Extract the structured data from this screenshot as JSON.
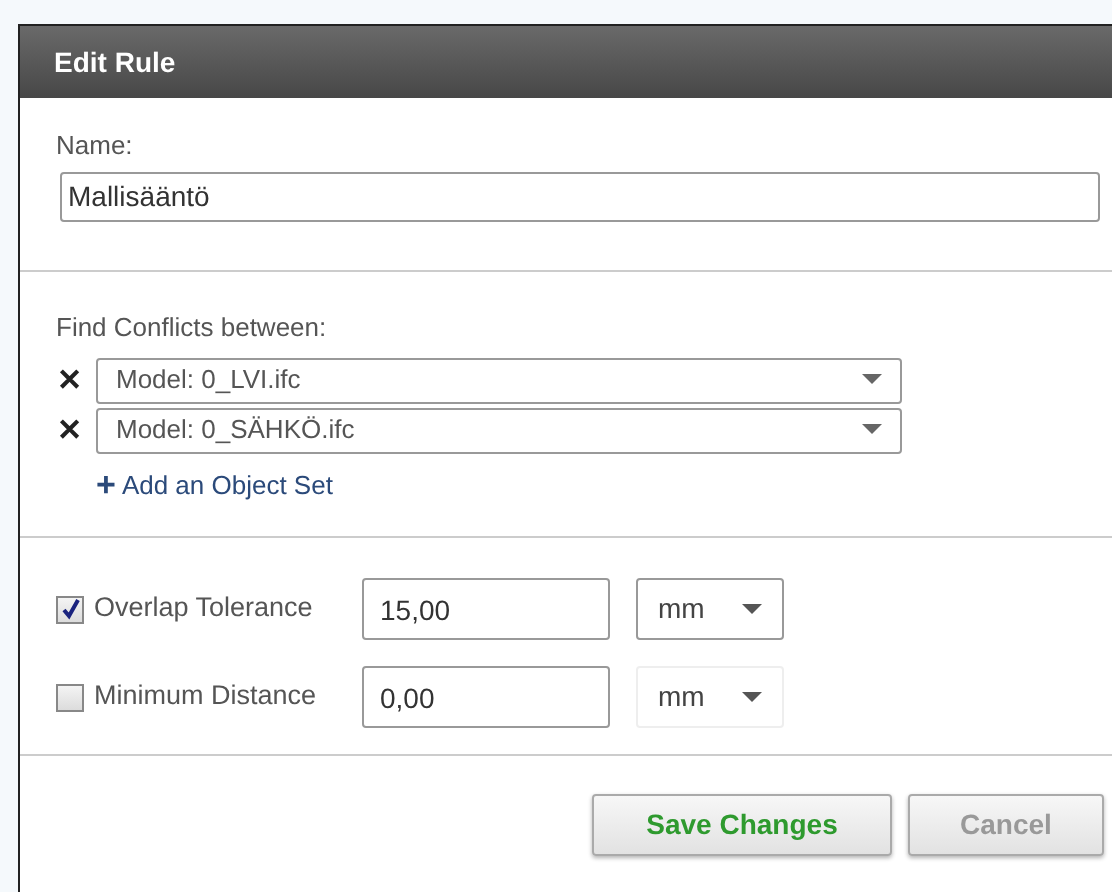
{
  "dialog": {
    "title": "Edit Rule"
  },
  "name_field": {
    "label": "Name:",
    "value": "Mallisääntö"
  },
  "conflicts": {
    "label": "Find Conflicts between:",
    "object_sets": [
      {
        "remove": "✕",
        "value": "Model: 0_LVI.ifc"
      },
      {
        "remove": "✕",
        "value": "Model: 0_SÄHKÖ.ifc"
      }
    ],
    "add_link": {
      "icon": "+",
      "label": "Add an Object Set"
    }
  },
  "tolerances": [
    {
      "label": "Overlap Tolerance",
      "checked": true,
      "value": "15,00",
      "unit": "mm",
      "unit_disabled": false
    },
    {
      "label": "Minimum Distance",
      "checked": false,
      "value": "0,00",
      "unit": "mm",
      "unit_disabled": true
    }
  ],
  "buttons": [
    {
      "kind": "primary",
      "label": "Save Changes"
    },
    {
      "kind": "secondary",
      "label": "Cancel"
    }
  ]
}
